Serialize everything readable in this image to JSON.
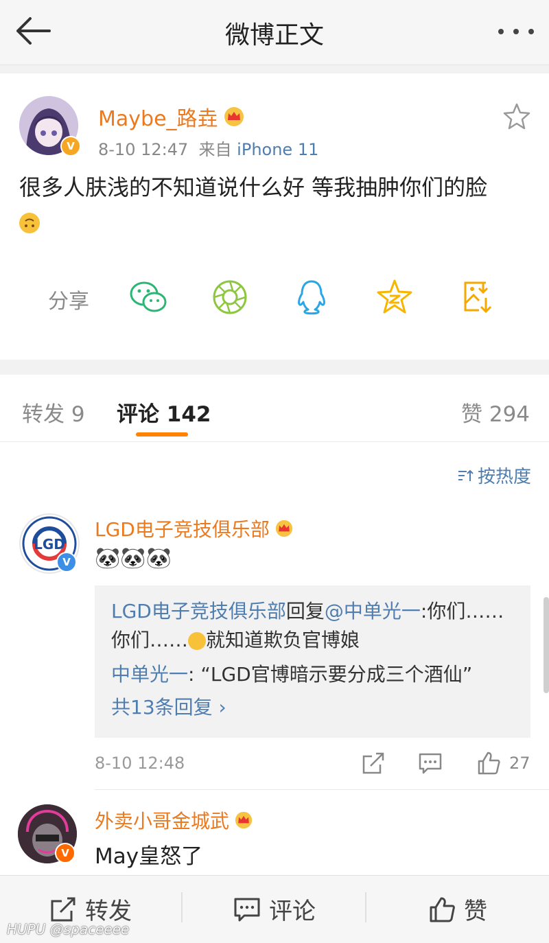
{
  "header": {
    "title": "微博正文"
  },
  "post": {
    "username": "Maybe_路垚",
    "time": "8-10 12:47",
    "from_label": "来自",
    "source": "iPhone 11",
    "text": "很多人肤浅的不知道说什么好 等我抽肿你们的脸",
    "emoji": "upside-down-face-emoji"
  },
  "share": {
    "label": "分享",
    "icons": [
      "wechat-icon",
      "moments-icon",
      "qq-icon",
      "qzone-icon",
      "save-image-icon"
    ]
  },
  "tabs": {
    "repost": "转发 9",
    "comment": "评论 142",
    "like": "赞 294"
  },
  "sort_label": "按热度",
  "comments": [
    {
      "username": "LGD电子竞技俱乐部",
      "text": "🐼🐼🐼",
      "reply": {
        "author": "LGD电子竞技俱乐部",
        "reply_word": "回复",
        "mention": "@中单光一",
        "text1": ":你们……你们……",
        "text2": "就知道欺负官博娘",
        "quote_author": "中单光一",
        "quote_text": ": “LGD官博暗示要分成三个酒仙”",
        "more": "共13条回复 ›"
      },
      "time": "8-10 12:48",
      "likes": "27"
    },
    {
      "username": "外卖小哥金城武",
      "text": "May皇怒了"
    }
  ],
  "bottom_bar": {
    "repost": "转发",
    "comment": "评论",
    "like": "赞"
  },
  "watermark": "HUPU @spaceeee",
  "colors": {
    "accent": "#ff8200",
    "link": "#507daf",
    "username": "#eb7a1f"
  }
}
